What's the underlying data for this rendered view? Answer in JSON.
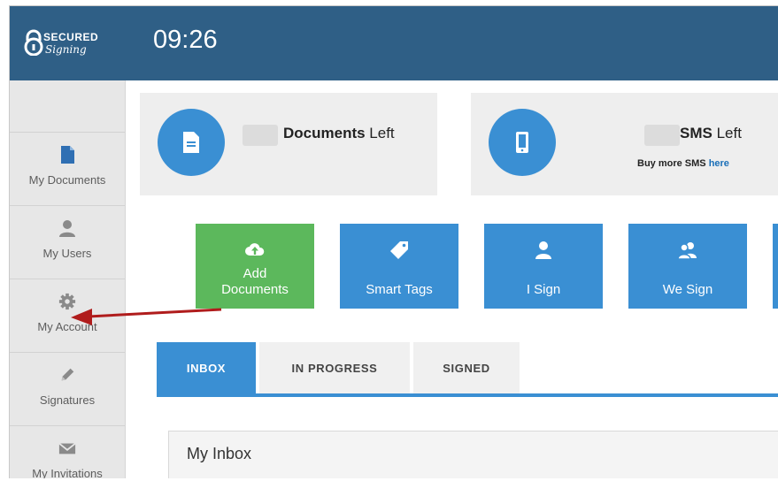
{
  "app": {
    "logo_text_top": "SECURED",
    "logo_text_bottom": "Signing",
    "clock": "09:26"
  },
  "sidebar": {
    "items": [
      {
        "label": "My Documents",
        "icon": "document-icon"
      },
      {
        "label": "My Users",
        "icon": "user-icon"
      },
      {
        "label": "My Account",
        "icon": "gear-icon"
      },
      {
        "label": "Signatures",
        "icon": "pencil-icon"
      },
      {
        "label": "My Invitations",
        "icon": "envelope-icon"
      }
    ]
  },
  "stats": {
    "documents": {
      "bold": "Documents",
      "rest": " Left"
    },
    "sms": {
      "bold": "SMS",
      "rest": " Left",
      "sub_text": "Buy more SMS ",
      "sub_link": "here"
    }
  },
  "actions": [
    {
      "label_line1": "Add",
      "label_line2": "Documents",
      "color": "#5cb85c",
      "icon": "cloud-upload-icon"
    },
    {
      "label_line1": "",
      "label_line2": "Smart Tags",
      "color": "#3a8fd3",
      "icon": "tag-icon"
    },
    {
      "label_line1": "",
      "label_line2": "I Sign",
      "color": "#3a8fd3",
      "icon": "user-icon"
    },
    {
      "label_line1": "",
      "label_line2": "We Sign",
      "color": "#3a8fd3",
      "icon": "users-icon"
    }
  ],
  "tabs": [
    {
      "label": "INBOX",
      "active": true
    },
    {
      "label": "IN PROGRESS",
      "active": false
    },
    {
      "label": "SIGNED",
      "active": false
    }
  ],
  "inbox": {
    "title": "My Inbox"
  },
  "colors": {
    "header": "#2f5f86",
    "accent": "#3a8fd3",
    "green": "#5cb85c",
    "annotation_arrow": "#b01c1c"
  }
}
